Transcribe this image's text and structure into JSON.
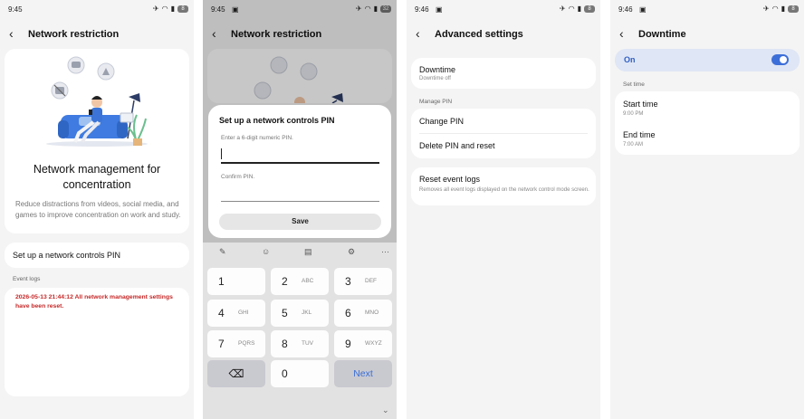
{
  "screen1": {
    "status_time": "9:45",
    "battery": "8",
    "title": "Network restriction",
    "hero_title": "Network management for concentration",
    "hero_desc": "Reduce distractions from videos, social media, and games to improve concentration on work and study.",
    "pin_row_label": "Set up a network controls PIN",
    "logs_label": "Event logs",
    "log_entry": "2026-05-13 21:44:12 All network management settings have been reset."
  },
  "screen2": {
    "status_time": "9:45",
    "battery": "32",
    "title": "Network restriction",
    "dialog_title": "Set up a network controls PIN",
    "pin_label": "Enter a 6-digit numeric PIN.",
    "confirm_label": "Confirm PIN.",
    "save_label": "Save",
    "keys": [
      {
        "num": "1",
        "letters": ""
      },
      {
        "num": "2",
        "letters": "ABC"
      },
      {
        "num": "3",
        "letters": "DEF"
      },
      {
        "num": "4",
        "letters": "GHI"
      },
      {
        "num": "5",
        "letters": "JKL"
      },
      {
        "num": "6",
        "letters": "MNO"
      },
      {
        "num": "7",
        "letters": "PQRS"
      },
      {
        "num": "8",
        "letters": "TUV"
      },
      {
        "num": "9",
        "letters": "WXYZ"
      }
    ],
    "zero_key": "0",
    "next_key": "Next",
    "toolbar_more": "···"
  },
  "screen3": {
    "status_time": "9:46",
    "battery": "8",
    "title": "Advanced settings",
    "downtime_label": "Downtime",
    "downtime_sub": "Downtime off",
    "manage_pin_label": "Manage PIN",
    "change_pin": "Change PIN",
    "delete_pin": "Delete PIN and reset",
    "reset_logs": "Reset event logs",
    "reset_logs_sub": "Removes all event logs displayed on the network control mode screen."
  },
  "screen4": {
    "status_time": "9:46",
    "battery": "8",
    "title": "Downtime",
    "toggle_label": "On",
    "toggle_on": true,
    "set_time_label": "Set time",
    "start_label": "Start time",
    "start_value": "9:00 PM",
    "end_label": "End time",
    "end_value": "7:00 AM"
  },
  "colors": {
    "accent": "#3d6fd8",
    "log_red": "#c62828",
    "background": "#f4f4f4"
  }
}
